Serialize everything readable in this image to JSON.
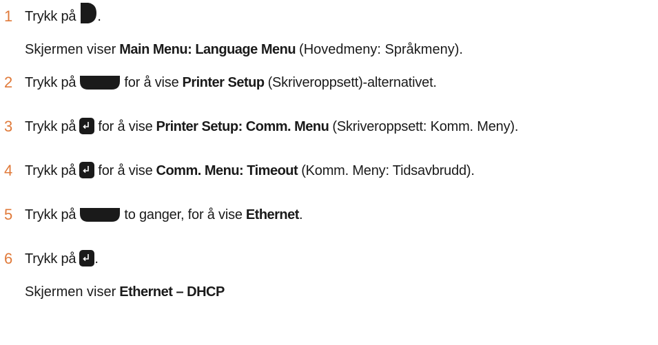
{
  "steps": [
    {
      "number": "1",
      "parts": {
        "a": "Trykk på",
        "dot": "."
      }
    },
    {
      "number": "2",
      "parts": {
        "a": "Trykk på",
        "b": "for å vise",
        "c": "Printer Setup",
        "d": "(Skriveroppsett)-alternativet."
      }
    },
    {
      "number": "3",
      "parts": {
        "a": "Trykk på",
        "b": "for å vise",
        "c": "Printer Setup: Comm. Menu",
        "d": "(Skriveroppsett: Komm. Meny)."
      }
    },
    {
      "number": "4",
      "parts": {
        "a": "Trykk på",
        "b": "for å vise",
        "c": "Comm. Menu: Timeout",
        "d": "(Komm. Meny: Tidsavbrudd)."
      }
    },
    {
      "number": "5",
      "parts": {
        "a": "Trykk på",
        "b": "to ganger, for å vise",
        "c": "Ethernet",
        "dot": "."
      }
    },
    {
      "number": "6",
      "parts": {
        "a": "Trykk på",
        "dot": "."
      }
    }
  ],
  "result1": {
    "a": "Skjermen viser",
    "b": "Main Menu: Language Menu",
    "c": "(Hovedmeny: Språkmeny)."
  },
  "result6": {
    "a": "Skjermen viser",
    "b": "Ethernet – DHCP"
  },
  "icons": {
    "step1": "next-button-icon",
    "step2": "down-button-icon",
    "step3": "enter-button-icon",
    "step4": "enter-button-icon",
    "step5": "down-button-icon",
    "step6": "enter-button-icon"
  },
  "colors": {
    "step_number": "#e07a3a",
    "text": "#1a1a1a",
    "icon": "#1a1a1a"
  }
}
